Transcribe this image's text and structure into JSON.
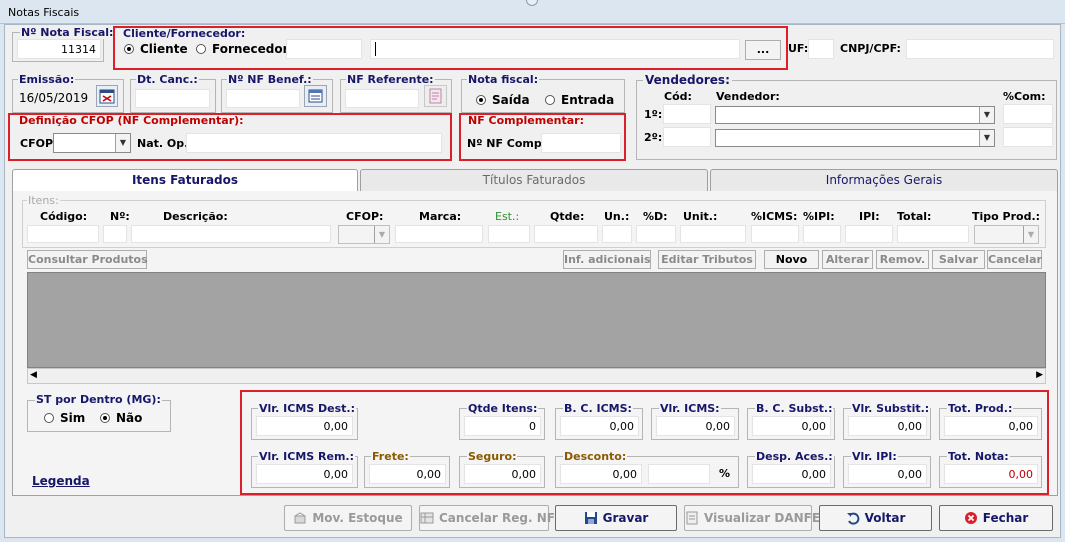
{
  "window": {
    "title": "Notas Fiscais"
  },
  "header": {
    "nota_fiscal_label": "Nº Nota Fiscal:",
    "nota_fiscal_value": "11314",
    "cliente_group_label": "Cliente/Fornecedor:",
    "radio_cliente": "Cliente",
    "radio_fornecedor": "Fornecedor",
    "browse_label": "...",
    "uf_label": "UF:",
    "cnpj_label": "CNPJ/CPF:"
  },
  "row2": {
    "emissao_label": "Emissão:",
    "emissao_value": "16/05/2019",
    "dt_canc_label": "Dt. Canc.:",
    "nf_benef_label": "Nº NF Benef.:",
    "nf_referente_label": "NF Referente:",
    "nota_fiscal_group_label": "Nota fiscal:",
    "radio_saida": "Saída",
    "radio_entrada": "Entrada"
  },
  "cfop": {
    "group_label": "Definição CFOP (NF Complementar):",
    "cfop_label": "CFOP:",
    "nat_op_label": "Nat. Op.:"
  },
  "nf_complementar": {
    "group_label": "NF Complementar:",
    "nf_comp_label": "Nº NF  Comp.:"
  },
  "vendedores": {
    "group_label": "Vendedores:",
    "cod_label": "Cód:",
    "vendedor_label": "Vendedor:",
    "com_label": "%Com:",
    "row1_label": "1º:",
    "row2_label": "2º:"
  },
  "tabs": [
    {
      "label": "Itens Faturados"
    },
    {
      "label": "Títulos Faturados"
    },
    {
      "label": "Informações Gerais"
    }
  ],
  "itens": {
    "group_label": "Itens:",
    "columns": {
      "codigo": "Código:",
      "numero": "Nº:",
      "descricao": "Descrição:",
      "cfop": "CFOP:",
      "marca": "Marca:",
      "est": "Est.:",
      "qtde": "Qtde:",
      "un": "Un.:",
      "pct_d": "%D:",
      "unit": "Unit.:",
      "pct_icms": "%ICMS:",
      "pct_ipi": "%IPI:",
      "ipi": "IPI:",
      "total": "Total:",
      "tipo_prod": "Tipo Prod.:"
    },
    "buttons": {
      "consultar": "Consultar Produtos",
      "inf_adicionais": "Inf. adicionais",
      "editar_tributos": "Editar Tributos",
      "novo": "Novo",
      "alterar": "Alterar",
      "remover": "Remov.",
      "salvar": "Salvar",
      "cancelar": "Cancelar"
    }
  },
  "st": {
    "group_label": "ST por Dentro (MG):",
    "sim": "Sim",
    "nao": "Não"
  },
  "totals": {
    "vlr_icms_dest": {
      "label": "Vlr. ICMS Dest.:",
      "value": "0,00"
    },
    "qtde_itens": {
      "label": "Qtde Itens:",
      "value": "0"
    },
    "bc_icms": {
      "label": "B. C. ICMS:",
      "value": "0,00"
    },
    "vlr_icms": {
      "label": "Vlr. ICMS:",
      "value": "0,00"
    },
    "bc_subst": {
      "label": "B. C. Subst.:",
      "value": "0,00"
    },
    "vlr_subst": {
      "label": "Vlr. Substit.:",
      "value": "0,00"
    },
    "tot_prod": {
      "label": "Tot. Prod.:",
      "value": "0,00"
    },
    "vlr_icms_rem": {
      "label": "Vlr. ICMS Rem.:",
      "value": "0,00"
    },
    "frete": {
      "label": "Frete:",
      "value": "0,00"
    },
    "seguro": {
      "label": "Seguro:",
      "value": "0,00"
    },
    "desconto": {
      "label": "Desconto:",
      "value": "0,00",
      "pct_symbol": "%"
    },
    "desp_aces": {
      "label": "Desp. Aces.:",
      "value": "0,00"
    },
    "vlr_ipi": {
      "label": "Vlr. IPI:",
      "value": "0,00"
    },
    "tot_nota": {
      "label": "Tot. Nota:",
      "value": "0,00"
    }
  },
  "legenda": "Legenda",
  "footer": {
    "mov_estoque": "Mov. Estoque",
    "cancelar_reg": "Cancelar Reg. NF",
    "gravar": "Gravar",
    "visualizar_danfe": "Visualizar DANFE",
    "voltar": "Voltar",
    "fechar": "Fechar"
  },
  "icons": {
    "calendar": "calendar-icon",
    "list": "list-icon",
    "document": "document-icon",
    "save": "floppy-disk-icon",
    "back": "undo-arrow-icon",
    "close": "red-close-icon"
  },
  "colors": {
    "accent_red": "#d9202b",
    "label_blue": "#17176a",
    "red_label": "#c00000"
  }
}
